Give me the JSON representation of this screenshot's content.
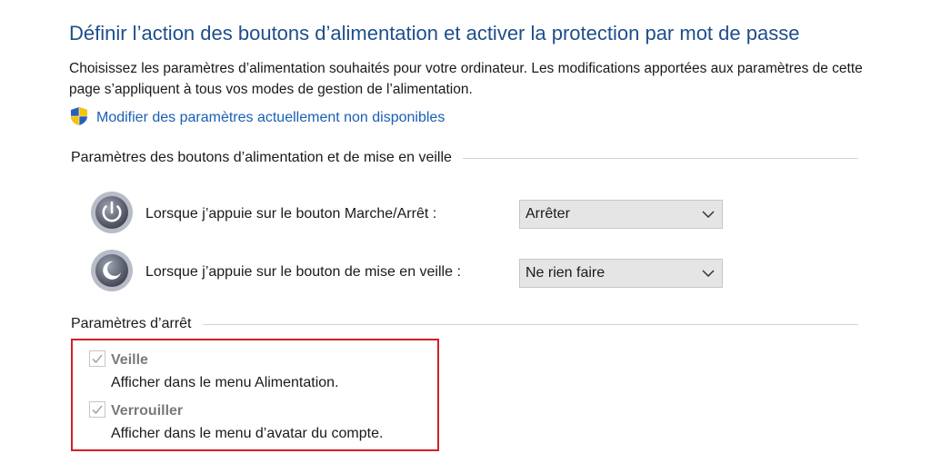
{
  "page": {
    "title": "Définir l’action des boutons d’alimentation et activer la protection par mot de passe",
    "description": "Choisissez les paramètres d’alimentation souhaités pour votre ordinateur. Les modifications apportées aux paramètres de cette page s’appliquent à tous vos modes de gestion de l’alimentation.",
    "admin_link": {
      "label": "Modifier des paramètres actuellement non disponibles",
      "icon": "uac-shield-icon"
    }
  },
  "power_buttons": {
    "section_title": "Paramètres des boutons d’alimentation et de mise en veille",
    "rows": [
      {
        "label": "Lorsque j’appuie sur le bouton Marche/Arrêt :",
        "selected": "Arrêter",
        "icon": "power-button-icon"
      },
      {
        "label": "Lorsque j’appuie sur le bouton de mise en veille :",
        "selected": "Ne rien faire",
        "icon": "sleep-button-icon"
      }
    ]
  },
  "shutdown": {
    "section_title": "Paramètres d’arrêt",
    "options": [
      {
        "label": "Veille",
        "description": "Afficher dans le menu Alimentation.",
        "checked": true,
        "disabled": true
      },
      {
        "label": "Verrouiller",
        "description": "Afficher dans le menu d’avatar du compte.",
        "checked": true,
        "disabled": true
      }
    ]
  },
  "colors": {
    "title": "#1e4e8c",
    "link": "#1a5fb4",
    "highlight_border": "#d21f26"
  }
}
